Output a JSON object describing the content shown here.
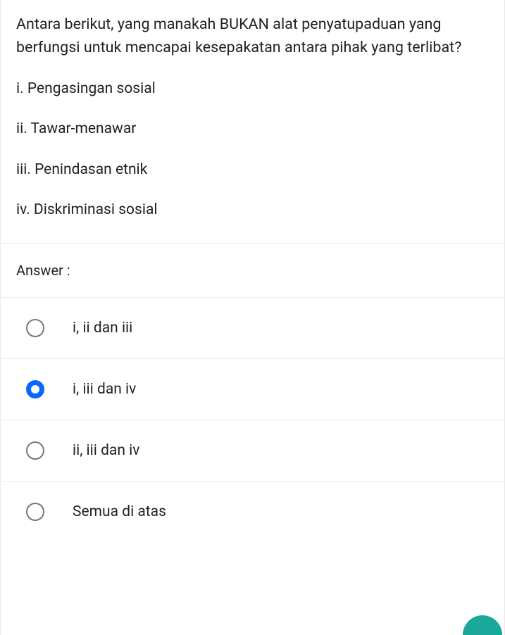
{
  "question": {
    "prompt": "Antara berikut, yang manakah BUKAN alat penyatupaduan yang berfungsi untuk mencapai kesepakatan antara pihak yang terlibat?",
    "items": [
      "i. Pengasingan sosial",
      "ii. Tawar-menawar",
      "iii. Penindasan etnik",
      "iv. Diskriminasi sosial"
    ]
  },
  "answer_label": "Answer :",
  "options": [
    {
      "label": "i, ii dan iii",
      "selected": false
    },
    {
      "label": "i, iii dan iv",
      "selected": true
    },
    {
      "label": "ii, iii dan iv",
      "selected": false
    },
    {
      "label": "Semua di atas",
      "selected": false
    }
  ]
}
